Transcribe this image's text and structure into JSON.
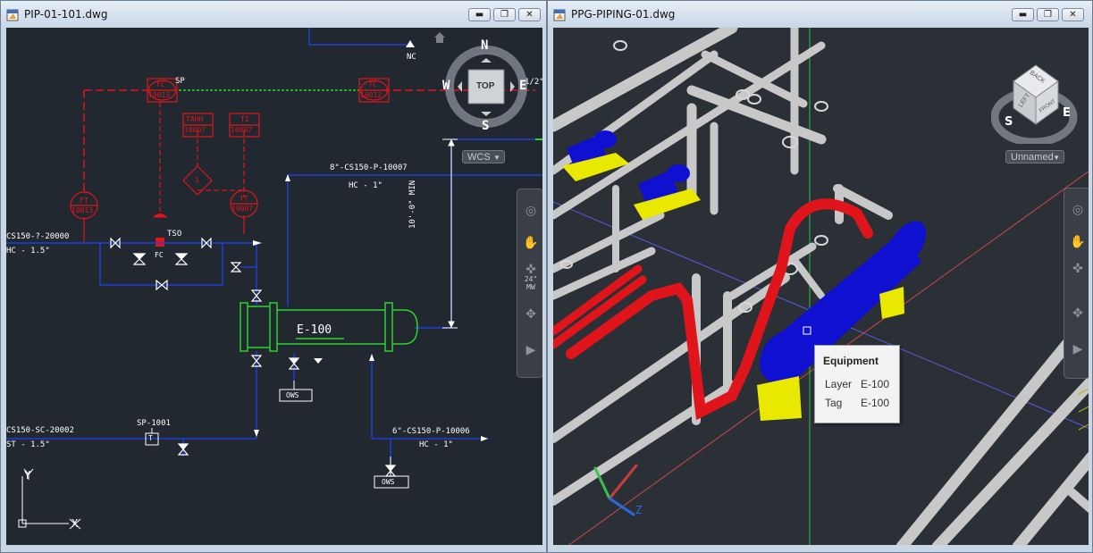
{
  "left_window": {
    "title": "PIP-01-101.dwg",
    "buttons": {
      "minimize": "▬",
      "restore": "❐",
      "close": "✕"
    },
    "viewcube": {
      "north": "N",
      "south": "S",
      "east": "E",
      "west": "W",
      "face": "TOP",
      "ucs": "WCS"
    },
    "navbar": {
      "scale_label": "24\" MW"
    },
    "labels": {
      "nc": "NC",
      "sp": "SP",
      "half_inch": "1/2\"",
      "fc_tag": "FC",
      "fc_num": "10013",
      "tc_tag": "TC",
      "tc_num": "10012",
      "tahh_tag": "TAHH",
      "tahh_num": "10007",
      "ti_tag": "TI",
      "ti_num": "10007",
      "ft_tag": "FT",
      "ft_num": "10013",
      "tt_tag": "TT",
      "tt_num": "10007",
      "interlock": "1",
      "tso": "TSO",
      "fc_valve": "FC",
      "line_top": "8\"-CS150-P-10007",
      "hc_top": "HC  -    1\"",
      "dim": "10'-0\" MIN",
      "line_left": "CS150-?-20000",
      "hc_left": "HC  -  1.5\"",
      "exchanger": "E-100",
      "ows1": "OWS",
      "ows2": "OWS",
      "sp1001": "SP-1001",
      "t_box": "T",
      "line_bottom_left": "CS150-SC-20002",
      "st_left": "ST  -   1.5\"",
      "line_bottom_right": "6\"-CS150-P-10006",
      "hc_bottom": "HC  -    1\"",
      "axis_y": "Y",
      "axis_x": "X"
    }
  },
  "right_window": {
    "title": "PPG-PIPING-01.dwg",
    "buttons": {
      "minimize": "▬",
      "restore": "❐",
      "close": "✕"
    },
    "viewcube": {
      "left": "LEFT",
      "back": "BACK",
      "front": "FRONT",
      "south": "S",
      "east": "E",
      "ucs": "Unnamed"
    },
    "tooltip": {
      "heading": "Equipment",
      "layer_key": "Layer",
      "layer_value": "E-100",
      "tag_key": "Tag",
      "tag_value": "E-100"
    },
    "axis_z": "Z"
  },
  "colors": {
    "cad_bg_2d": "#212830",
    "cad_bg_3d": "#2b3037",
    "instrument_red": "#e0141b",
    "process_blue": "#1e3ed8",
    "equipment_green": "#2ed12e",
    "pipe_grey": "#c8c8c8",
    "pump_blue": "#1010d0",
    "support_yellow": "#e8e800"
  }
}
